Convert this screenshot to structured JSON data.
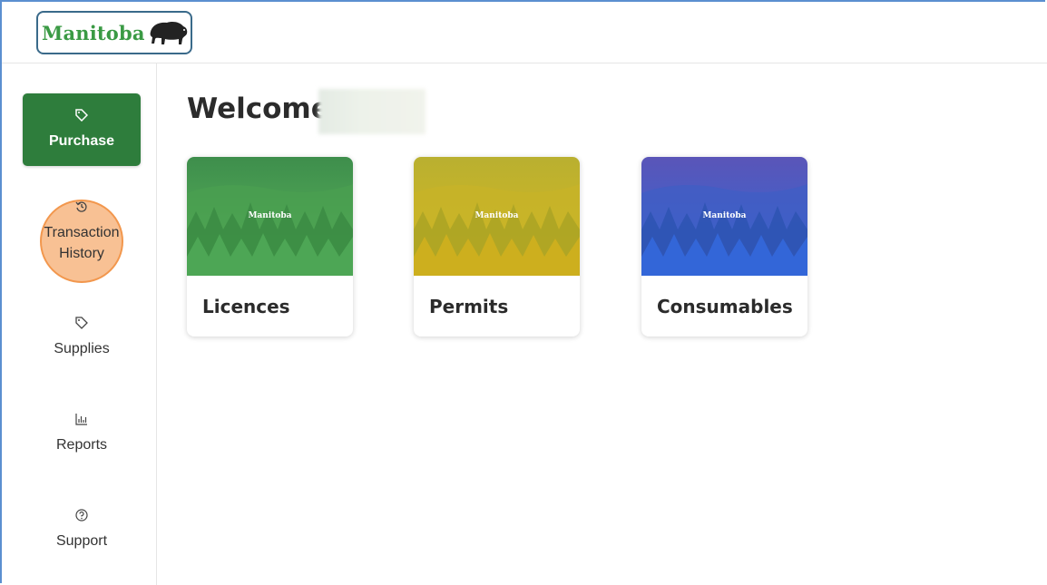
{
  "brand": {
    "name": "Manitoba",
    "color": "#3a9a44"
  },
  "sidebar": {
    "items": [
      {
        "label": "Purchase",
        "icon": "tag-icon",
        "active": true
      },
      {
        "label": "Transaction History",
        "icon": "history-icon",
        "active": false
      },
      {
        "label": "Supplies",
        "icon": "tag-icon",
        "active": false
      },
      {
        "label": "Reports",
        "icon": "bar-chart-icon",
        "active": false
      },
      {
        "label": "Support",
        "icon": "help-icon",
        "active": false
      }
    ]
  },
  "main": {
    "welcome": "Welcome",
    "cards": [
      {
        "title": "Licences",
        "logo_text": "Manitoba",
        "tint": "#3f9a4a"
      },
      {
        "title": "Permits",
        "logo_text": "Manitoba",
        "tint": "#c9b12a"
      },
      {
        "title": "Consumables",
        "logo_text": "Manitoba",
        "tint": "#3a5fc8"
      }
    ]
  },
  "colors": {
    "accent": "#2e7d3c",
    "highlight": "#f5a05a"
  }
}
